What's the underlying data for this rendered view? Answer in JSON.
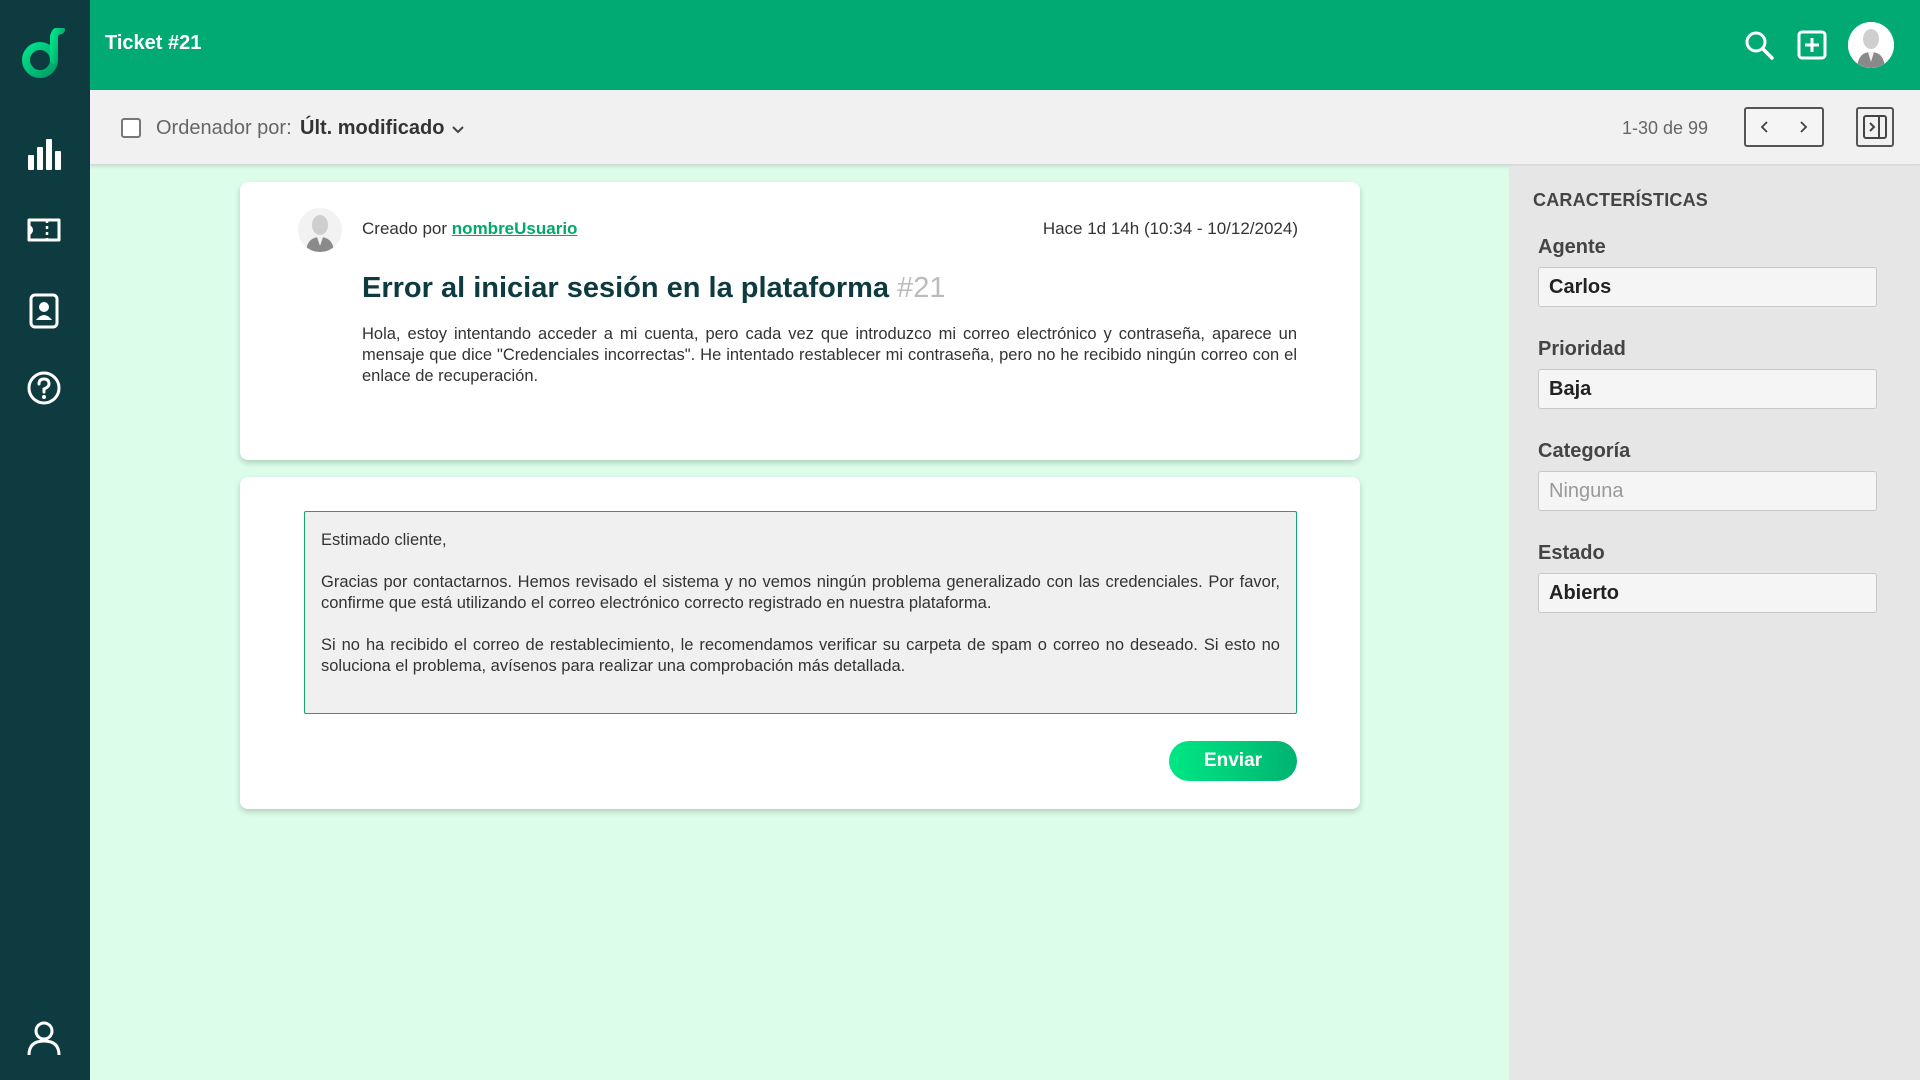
{
  "app": {
    "logo_icon": "d-logo",
    "accent": "#00aa72",
    "sidebar_color": "#0d3b40",
    "background": "#dbfde9"
  },
  "sidebar": {
    "items": [
      {
        "icon": "bar-chart-icon"
      },
      {
        "icon": "ticket-icon"
      },
      {
        "icon": "contact-card-icon"
      },
      {
        "icon": "help-icon"
      },
      {
        "icon": "user-icon"
      }
    ]
  },
  "header": {
    "title": "Ticket #21",
    "icons": [
      "search-icon",
      "add-box-icon",
      "avatar"
    ]
  },
  "toolbar": {
    "sort_label": "Ordenador por:",
    "sort_value": "Últ. modificado",
    "pager_text": "1-30 de 99"
  },
  "ticket": {
    "created_by_prefix": "Creado por",
    "author": "nombreUsuario",
    "timestamp": "Hace 1d 14h (10:34 - 10/12/2024)",
    "title": "Error al iniciar sesión en la plataforma",
    "number": "#21",
    "body": "Hola, estoy intentando acceder a mi cuenta, pero cada vez que introduzco mi correo electrónico y contraseña, aparece un mensaje que dice \"Credenciales incorrectas\". He intentado restablecer mi contraseña, pero no he recibido ningún correo con el enlace de recuperación."
  },
  "reply": {
    "greeting": "Estimado cliente,",
    "paragraph1": "Gracias por contactarnos. Hemos revisado el sistema y no vemos ningún problema generalizado con las credenciales. Por favor, confirme que está utilizando el correo electrónico correcto registrado en nuestra plataforma.",
    "paragraph2": "Si no ha recibido el correo de restablecimiento, le recomendamos verificar su carpeta de spam o correo no deseado. Si esto no soluciona el problema, avísenos para realizar una comprobación más detallada.",
    "send_label": "Enviar"
  },
  "characteristics": {
    "title": "CARACTERÍSTICAS",
    "fields": [
      {
        "label": "Agente",
        "value": "Carlos",
        "placeholder": false
      },
      {
        "label": "Prioridad",
        "value": "Baja",
        "placeholder": false
      },
      {
        "label": "Categoría",
        "value": "Ninguna",
        "placeholder": true
      },
      {
        "label": "Estado",
        "value": "Abierto",
        "placeholder": false
      }
    ]
  }
}
